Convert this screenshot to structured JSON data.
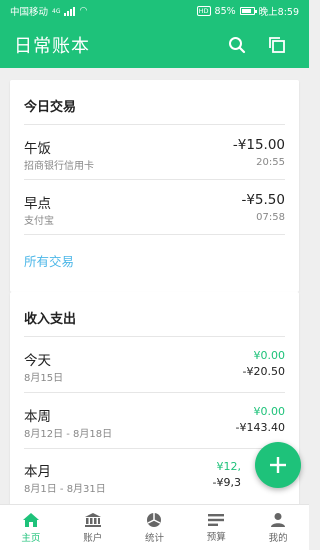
{
  "status": {
    "carrier": "中国移动",
    "network": "4G",
    "battery": "85%",
    "battery_level": 0.85,
    "time": "晚上8:59"
  },
  "app": {
    "title": "日常账本"
  },
  "today": {
    "title": "今日交易",
    "transactions": [
      {
        "name": "午饭",
        "account": "招商银行信用卡",
        "amount": "-¥15.00",
        "time": "20:55"
      },
      {
        "name": "早点",
        "account": "支付宝",
        "amount": "-¥5.50",
        "time": "07:58"
      }
    ],
    "all_link": "所有交易"
  },
  "income_expense": {
    "title": "收入支出",
    "rows": [
      {
        "name": "今天",
        "date": "8月15日",
        "income": "¥0.00",
        "expense": "-¥20.50"
      },
      {
        "name": "本周",
        "date": "8月12日 - 8月18日",
        "income": "¥0.00",
        "expense": "-¥143.40"
      },
      {
        "name": "本月",
        "date": "8月1日 - 8月31日",
        "income": "¥12,",
        "expense": "-¥9,3"
      }
    ]
  },
  "colors": {
    "brand": "#1ec27a",
    "link": "#4db7e8"
  },
  "nav": [
    {
      "label": "主页",
      "icon": "home-icon",
      "active": true
    },
    {
      "label": "账户",
      "icon": "bank-icon",
      "active": false
    },
    {
      "label": "统计",
      "icon": "pie-chart-icon",
      "active": false
    },
    {
      "label": "预算",
      "icon": "budget-list-icon",
      "active": false
    },
    {
      "label": "我的",
      "icon": "person-icon",
      "active": false
    }
  ]
}
